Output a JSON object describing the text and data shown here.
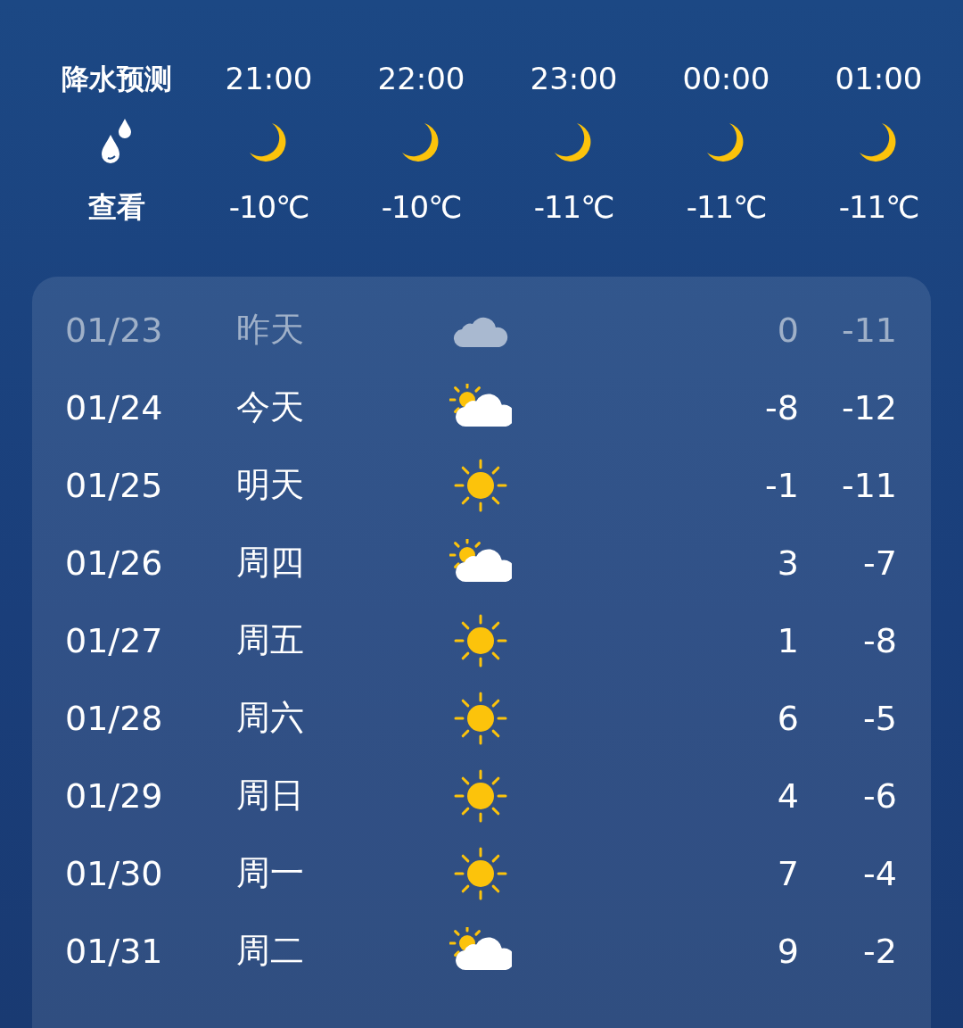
{
  "hourly": {
    "precipitation": {
      "title": "降水预测",
      "link": "查看"
    },
    "hours": [
      {
        "time": "21:00",
        "kind": "moon",
        "temp": "-10℃"
      },
      {
        "time": "22:00",
        "kind": "moon",
        "temp": "-10℃"
      },
      {
        "time": "23:00",
        "kind": "moon",
        "temp": "-11℃"
      },
      {
        "time": "00:00",
        "kind": "moon",
        "temp": "-11℃"
      },
      {
        "time": "01:00",
        "kind": "moon",
        "temp": "-11℃"
      }
    ]
  },
  "daily": [
    {
      "date": "01/23",
      "day": "昨天",
      "kind": "cloudy",
      "high": "0",
      "low": "-11",
      "past": true
    },
    {
      "date": "01/24",
      "day": "今天",
      "kind": "partly-cloudy",
      "high": "-8",
      "low": "-12",
      "past": false
    },
    {
      "date": "01/25",
      "day": "明天",
      "kind": "sunny",
      "high": "-1",
      "low": "-11",
      "past": false
    },
    {
      "date": "01/26",
      "day": "周四",
      "kind": "partly-cloudy",
      "high": "3",
      "low": "-7",
      "past": false
    },
    {
      "date": "01/27",
      "day": "周五",
      "kind": "sunny",
      "high": "1",
      "low": "-8",
      "past": false
    },
    {
      "date": "01/28",
      "day": "周六",
      "kind": "sunny",
      "high": "6",
      "low": "-5",
      "past": false
    },
    {
      "date": "01/29",
      "day": "周日",
      "kind": "sunny",
      "high": "4",
      "low": "-6",
      "past": false
    },
    {
      "date": "01/30",
      "day": "周一",
      "kind": "sunny",
      "high": "7",
      "low": "-4",
      "past": false
    },
    {
      "date": "01/31",
      "day": "周二",
      "kind": "partly-cloudy",
      "high": "9",
      "low": "-2",
      "past": false
    }
  ]
}
